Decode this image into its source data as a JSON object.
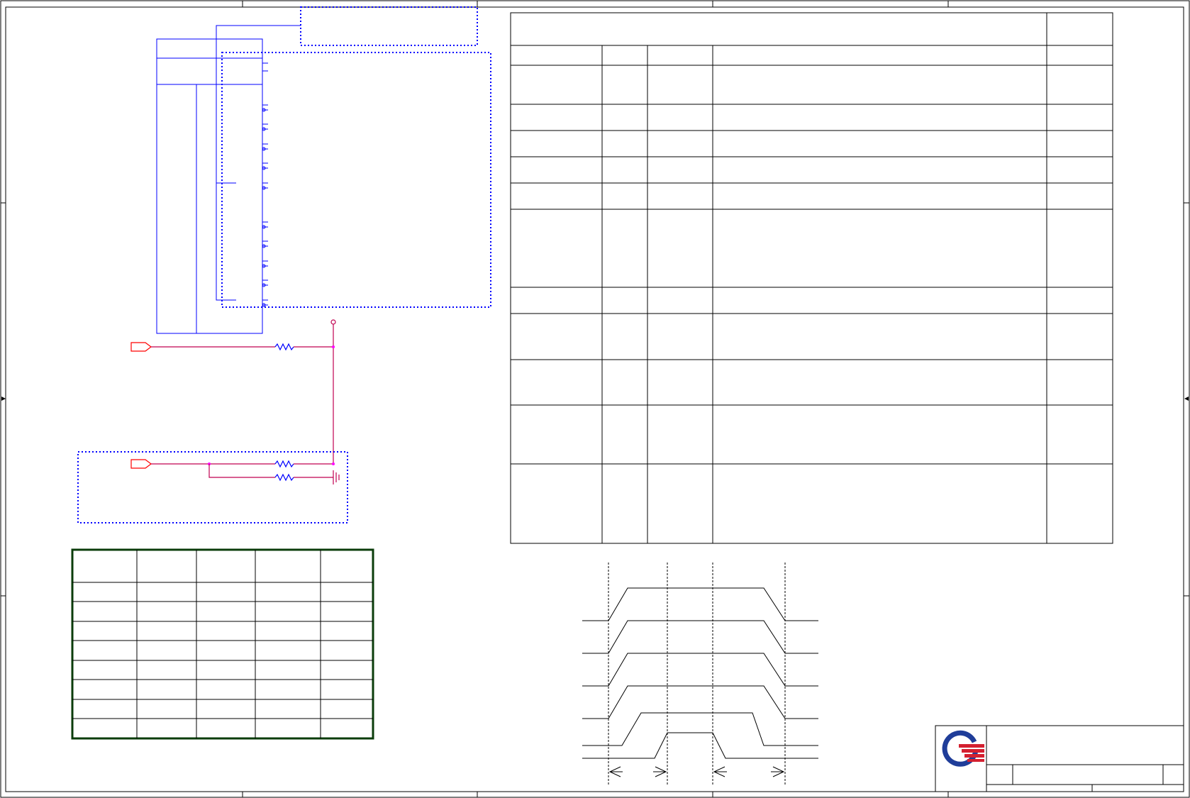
{
  "colors": {
    "frame": "#000000",
    "bus_wire": "#0000ff",
    "net_wire": "#c00050",
    "port": "#ff0000",
    "junction": "#ff00ff",
    "dotted_box": "#0000ff",
    "gpio_table_border": "#0b3d0b",
    "logo_blue": "#1f3d99",
    "logo_red": "#d42030"
  },
  "icons": {
    "logo": "company-logo-icon",
    "resistor": "resistor-icon",
    "ground": "ground-icon",
    "power": "power-pin-icon",
    "port": "offpage-connector-icon"
  },
  "text": {}
}
